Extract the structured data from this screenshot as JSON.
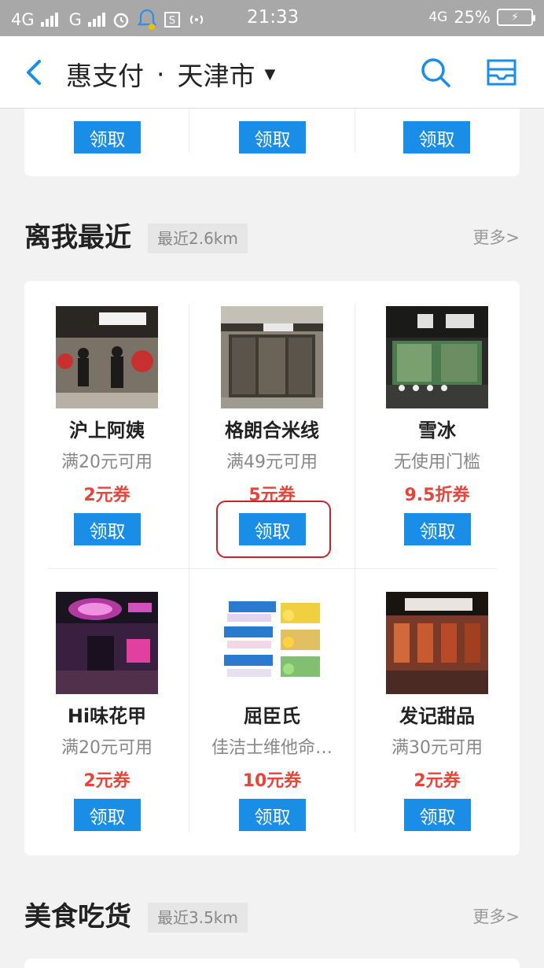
{
  "status_bar": {
    "network1": "4G",
    "network2": "G",
    "time": "21:33",
    "network3": "4G",
    "battery_percent": "25%"
  },
  "nav": {
    "title": "惠支付",
    "separator": "·",
    "city": "天津市"
  },
  "top_card": {
    "buttons": [
      "领取",
      "领取",
      "领取"
    ]
  },
  "nearby_section": {
    "title": "离我最近",
    "distance": "最近2.6km",
    "more": "更多>"
  },
  "stores": [
    {
      "name": "沪上阿姨",
      "condition": "满20元可用",
      "coupon": "2元券",
      "button": "领取"
    },
    {
      "name": "格朗合米线",
      "condition": "满49元可用",
      "coupon": "5元券",
      "button": "领取"
    },
    {
      "name": "雪冰",
      "condition": "无使用门槛",
      "coupon": "9.5折券",
      "button": "领取"
    },
    {
      "name": "Hi味花甲",
      "condition": "满20元可用",
      "coupon": "2元券",
      "button": "领取"
    },
    {
      "name": "屈臣氏",
      "condition": "佳洁士维他命…",
      "coupon": "10元券",
      "button": "领取"
    },
    {
      "name": "发记甜品",
      "condition": "满30元可用",
      "coupon": "2元券",
      "button": "领取"
    }
  ],
  "food_section": {
    "title": "美食吃货",
    "distance": "最近3.5km",
    "more": "更多>"
  },
  "colors": {
    "accent": "#1a8de6",
    "coupon_red": "#e6453a",
    "highlight_red": "#c8222a"
  }
}
